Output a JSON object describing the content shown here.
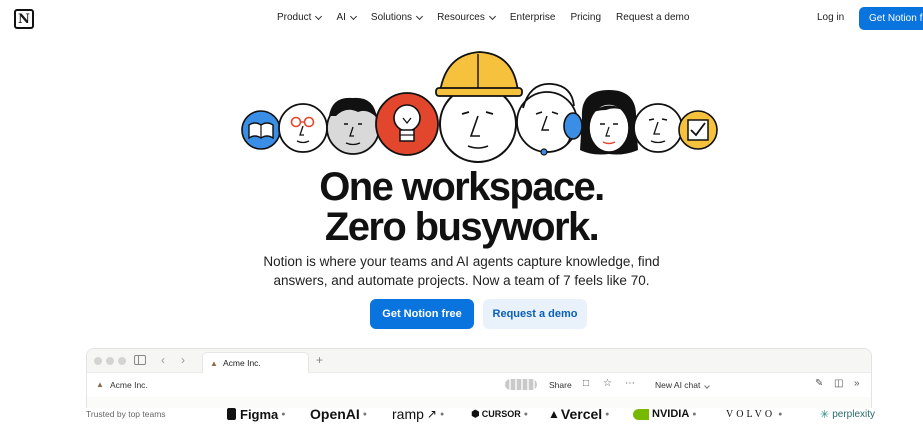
{
  "nav": {
    "logo_letter": "N",
    "items": [
      {
        "label": "Product",
        "has_menu": true
      },
      {
        "label": "AI",
        "has_menu": true
      },
      {
        "label": "Solutions",
        "has_menu": true
      },
      {
        "label": "Resources",
        "has_menu": true
      },
      {
        "label": "Enterprise",
        "has_menu": false
      },
      {
        "label": "Pricing",
        "has_menu": false
      },
      {
        "label": "Request a demo",
        "has_menu": false
      }
    ],
    "login": "Log in",
    "cta": "Get Notion free"
  },
  "hero": {
    "headline_line1": "One workspace.",
    "headline_line2": "Zero busywork.",
    "subhead_line1": "Notion is where your teams and AI agents capture knowledge, find",
    "subhead_line2": "answers, and automate projects. Now a team of 7 feels like 70.",
    "primary_button": "Get Notion free",
    "secondary_button": "Request a demo",
    "illustration_icons": [
      "open-book-icon",
      "glasses-face-icon",
      "curly-hair-face-icon",
      "lightbulb-icon",
      "hardhat-face-icon",
      "headset-face-icon",
      "long-hair-face-icon",
      "plain-face-icon",
      "checklist-icon"
    ]
  },
  "app_preview": {
    "tab_label": "Acme Inc.",
    "breadcrumb": "Acme Inc.",
    "share_label": "Share",
    "chat_label": "New AI chat"
  },
  "trusted": {
    "label": "Trusted by top teams",
    "brands": [
      "Figma",
      "OpenAI",
      "ramp",
      "CURSOR",
      "Vercel",
      "NVIDIA",
      "VOLVO",
      "perplexity"
    ]
  },
  "colors": {
    "accent": "#0a74de",
    "secondary_button_bg": "#e9f2fb",
    "illustration_blue": "#3a8ee6",
    "illustration_red": "#e2472e",
    "illustration_yellow": "#f6c23e"
  }
}
